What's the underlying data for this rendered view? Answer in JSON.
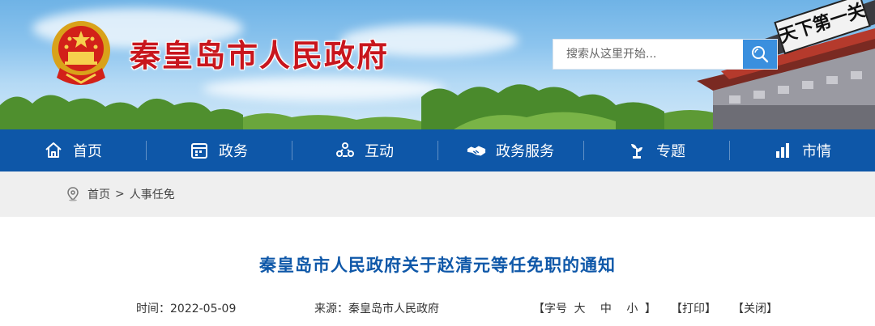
{
  "header": {
    "site_title": "秦皇岛市人民政府",
    "search_placeholder": "搜索从这里开始...",
    "building_plaque": "天下第一关"
  },
  "nav": [
    {
      "label": "首页",
      "icon": "home-icon"
    },
    {
      "label": "政务",
      "icon": "calendar-icon"
    },
    {
      "label": "互动",
      "icon": "people-icon"
    },
    {
      "label": "政务服务",
      "icon": "handshake-icon"
    },
    {
      "label": "专题",
      "icon": "plant-icon"
    },
    {
      "label": "市情",
      "icon": "bar-chart-icon"
    }
  ],
  "breadcrumb": {
    "home": "首页",
    "separator": ">",
    "current": "人事任免"
  },
  "article": {
    "title": "秦皇岛市人民政府关于赵清元等任免职的通知",
    "time_label": "时间：",
    "time_value": "2022-05-09",
    "source_label": "来源：",
    "source_value": "秦皇岛市人民政府",
    "font_size_prefix": "【字号",
    "font_large": "大",
    "font_medium": "中",
    "font_small": "小",
    "font_size_suffix": "】",
    "print": "【打印】",
    "close": "【关闭】"
  },
  "colors": {
    "nav_blue": "#0e57a8",
    "title_red": "#c8161d",
    "search_blue": "#3a8fde"
  }
}
